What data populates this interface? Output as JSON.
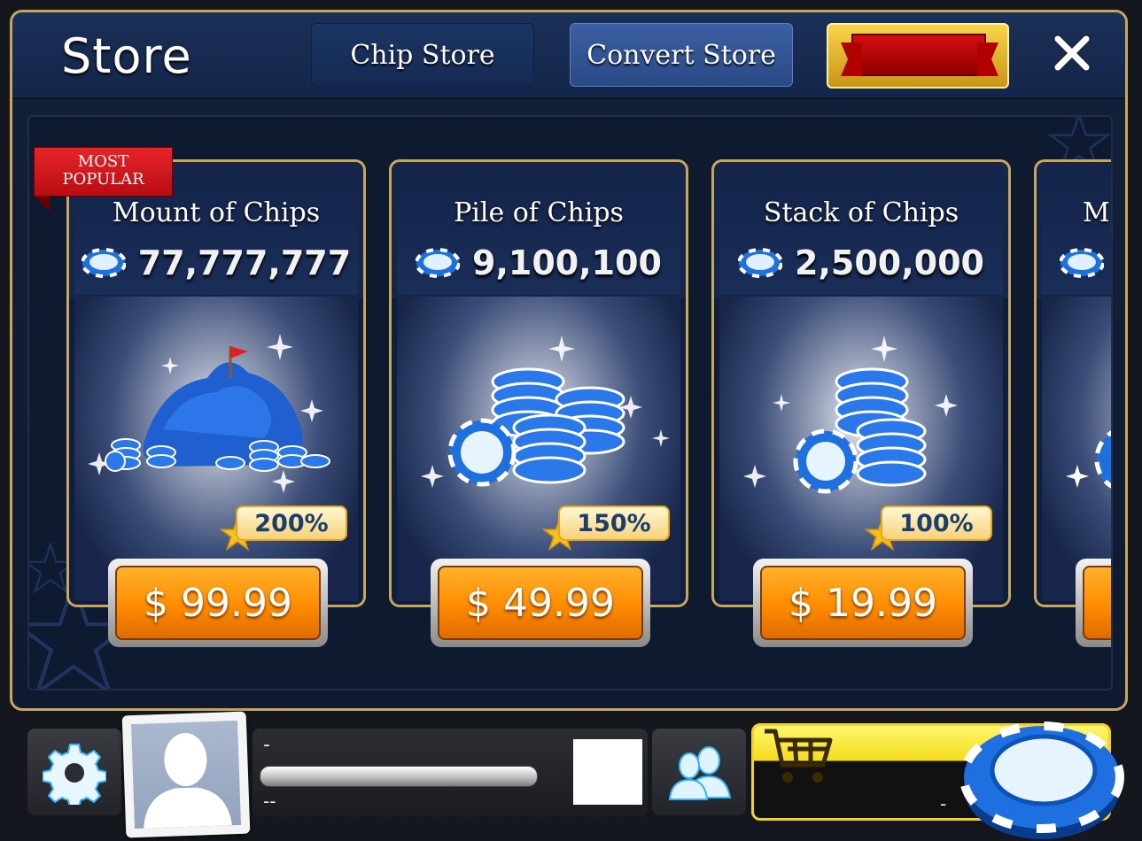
{
  "store": {
    "title": "Store",
    "tabs": [
      {
        "label": "Chip Store",
        "active": false
      },
      {
        "label": "Convert Store",
        "active": true
      }
    ],
    "special_tab_icon": "red-ribbon-banner",
    "close_icon": "close-icon"
  },
  "packs": [
    {
      "title": "Mount of Chips",
      "amount": "77,777,777",
      "bonus": "200%",
      "price": "$ 99.99",
      "badge": "MOST POPULAR",
      "art": "chip-mountain-with-flag"
    },
    {
      "title": "Pile of Chips",
      "amount": "9,100,100",
      "bonus": "150%",
      "price": "$ 49.99",
      "art": "chip-pile"
    },
    {
      "title": "Stack of Chips",
      "amount": "2,500,000",
      "bonus": "100%",
      "price": "$ 19.99",
      "art": "chip-stack"
    },
    {
      "title": "M",
      "art": "chip-partial"
    }
  ],
  "badge": {
    "line1": "MOST",
    "line2": "POPULAR"
  },
  "bottom_bar": {
    "settings_icon": "gear-icon",
    "avatar_icon": "profile-silhouette",
    "profile_name": "-",
    "profile_level_text": "--",
    "friends_icon": "friends-icon",
    "cart_icon": "shopping-cart-icon",
    "balance": "-",
    "chip_icon": "poker-chip"
  },
  "colors": {
    "gold_border": "#c8a75a",
    "panel_blue": "#14254a",
    "price_orange": "#ff8c00",
    "bonus_text": "#1b3f6c",
    "popular_red": "#d41b20",
    "buy_yellow": "#f4dd1a",
    "chip_blue": "#1e6fe0"
  }
}
